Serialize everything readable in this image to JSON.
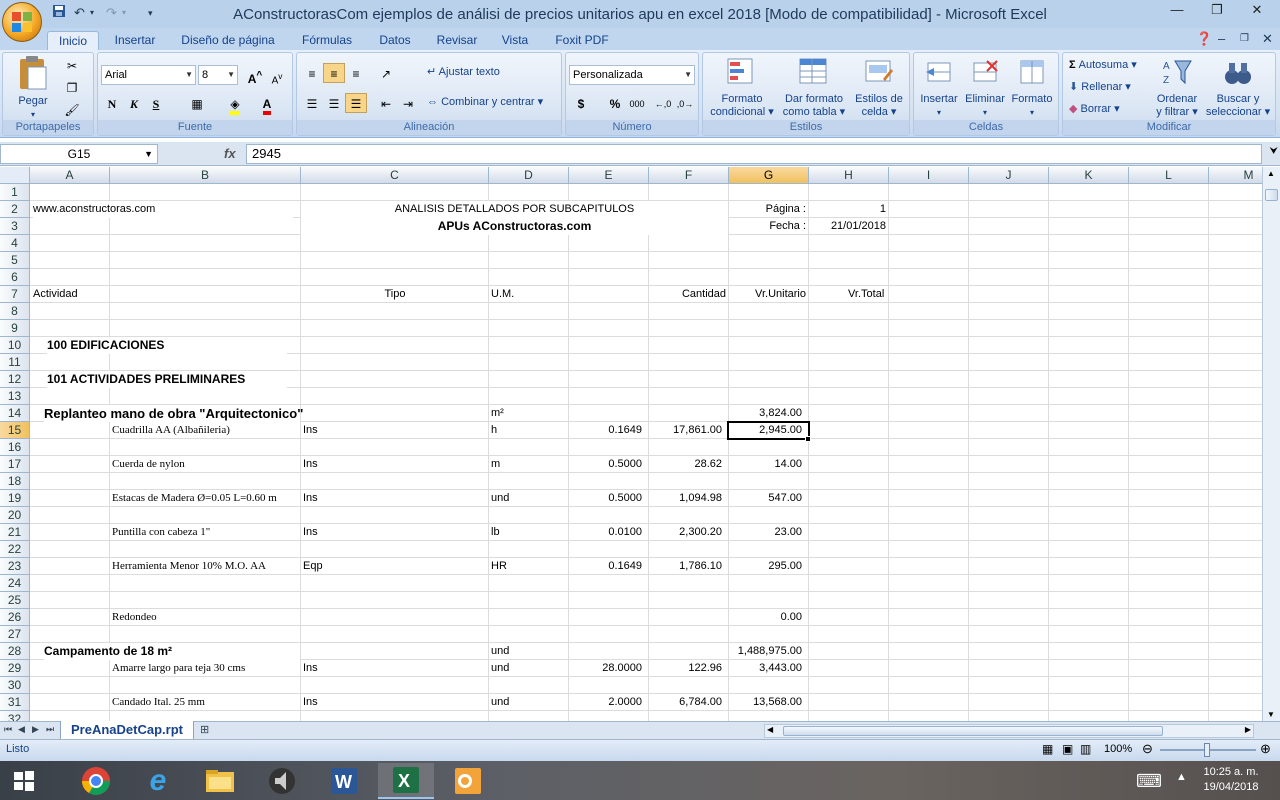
{
  "window": {
    "title": "AConstructorasCom ejemplos de análisi de precios unitarios apu en excel 2018  [Modo de compatibilidad] - Microsoft Excel"
  },
  "ribbon": {
    "tabs": [
      "Inicio",
      "Insertar",
      "Diseño de página",
      "Fórmulas",
      "Datos",
      "Revisar",
      "Vista",
      "Foxit PDF"
    ],
    "active_tab": "Inicio",
    "portapapeles": {
      "paste_label": "Pegar",
      "group_label": "Portapapeles"
    },
    "fuente": {
      "font_name": "Arial",
      "font_size": "8",
      "bold": "N",
      "italic": "K",
      "underline": "S",
      "group_label": "Fuente"
    },
    "alineacion": {
      "wrap_label": "Ajustar texto",
      "merge_label": "Combinar y centrar",
      "group_label": "Alineación"
    },
    "numero": {
      "format_value": "Personalizada",
      "currency": "$",
      "percent": "%",
      "thousands": "000",
      "group_label": "Número"
    },
    "estilos": {
      "conditional_l1": "Formato",
      "conditional_l2": "condicional",
      "table_l1": "Dar formato",
      "table_l2": "como tabla",
      "cellstyle_l1": "Estilos de",
      "cellstyle_l2": "celda",
      "group_label": "Estilos"
    },
    "celdas": {
      "insert_label": "Insertar",
      "delete_label": "Eliminar",
      "format_label": "Formato",
      "group_label": "Celdas"
    },
    "modificar": {
      "autosum_label": "Autosuma",
      "fill_label": "Rellenar",
      "clear_label": "Borrar",
      "sort_l1": "Ordenar",
      "sort_l2": "y filtrar",
      "find_l1": "Buscar y",
      "find_l2": "seleccionar",
      "group_label": "Modificar"
    }
  },
  "formula_bar": {
    "name_box": "G15",
    "fx": "fx",
    "content": "2945"
  },
  "columns": [
    "A",
    "B",
    "C",
    "D",
    "E",
    "F",
    "G",
    "H",
    "I",
    "J",
    "K",
    "L",
    "M"
  ],
  "selected_column": "G",
  "selected_row": "15",
  "rows": [
    "1",
    "2",
    "3",
    "4",
    "5",
    "6",
    "7",
    "8",
    "9",
    "10",
    "11",
    "12",
    "13",
    "14",
    "15",
    "16",
    "17",
    "18",
    "19",
    "20",
    "21",
    "22",
    "23",
    "24",
    "25",
    "26",
    "27",
    "28",
    "29",
    "30",
    "31",
    "32"
  ],
  "cells": {
    "r2_a": "www.aconstructoras.com",
    "r2_c": "ANALISIS DETALLADOS POR SUBCAPITULOS",
    "r2_g": "Página :",
    "r2_h": "1",
    "r3_c": "APUs AConstructoras.com",
    "r3_g": "Fecha :",
    "r3_h": "21/01/2018",
    "r7_a": "Actividad",
    "r7_c": "Tipo",
    "r7_d": "U.M.",
    "r7_f": "Cantidad",
    "r7_g": "Vr.Unitario",
    "r7_h": "Vr.Total",
    "r10_a": "100   EDIFICACIONES",
    "r12_a": "101   ACTIVIDADES PRELIMINARES",
    "r14_a": "Replanteo mano de obra  \"Arquitectonico\"",
    "r14_d": "m²",
    "r14_g": "3,824.00",
    "r15_b": "Cuadrilla  AA (Albañileria)",
    "r15_c": "Ins",
    "r15_d": "h",
    "r15_e": "0.1649",
    "r15_f": "17,861.00",
    "r15_g": "2,945.00",
    "r17_b": "Cuerda de nylon",
    "r17_c": "Ins",
    "r17_d": "m",
    "r17_e": "0.5000",
    "r17_f": "28.62",
    "r17_g": "14.00",
    "r19_b": "Estacas de Madera Ø=0.05 L=0.60 m",
    "r19_c": "Ins",
    "r19_d": "und",
    "r19_e": "0.5000",
    "r19_f": "1,094.98",
    "r19_g": "547.00",
    "r21_b": "Puntilla con cabeza  1\"",
    "r21_c": "Ins",
    "r21_d": "lb",
    "r21_e": "0.0100",
    "r21_f": "2,300.20",
    "r21_g": "23.00",
    "r23_b": "Herramienta Menor 10% M.O. AA",
    "r23_c": "Eqp",
    "r23_d": "HR",
    "r23_e": "0.1649",
    "r23_f": "1,786.10",
    "r23_g": "295.00",
    "r26_b": "Redondeo",
    "r26_g": "0.00",
    "r28_a": "Campamento de 18 m²",
    "r28_d": "und",
    "r28_g": "1,488,975.00",
    "r29_b": "Amarre largo para teja 30 cms",
    "r29_c": "Ins",
    "r29_d": "und",
    "r29_e": "28.0000",
    "r29_f": "122.96",
    "r29_g": "3,443.00",
    "r31_b": "Candado Ital. 25 mm",
    "r31_c": "Ins",
    "r31_d": "und",
    "r31_e": "2.0000",
    "r31_f": "6,784.00",
    "r31_g": "13,568.00"
  },
  "sheet_tab": "PreAnaDetCap.rpt",
  "status": {
    "ready": "Listo",
    "zoom": "100%"
  },
  "taskbar": {
    "time": "10:25 a. m.",
    "date": "19/04/2018"
  },
  "colors": {
    "ribbon_bg": "#dbe5f1",
    "selection_header": "#f1c15f",
    "title_text": "#1e395b",
    "tab_text": "#15428b"
  }
}
